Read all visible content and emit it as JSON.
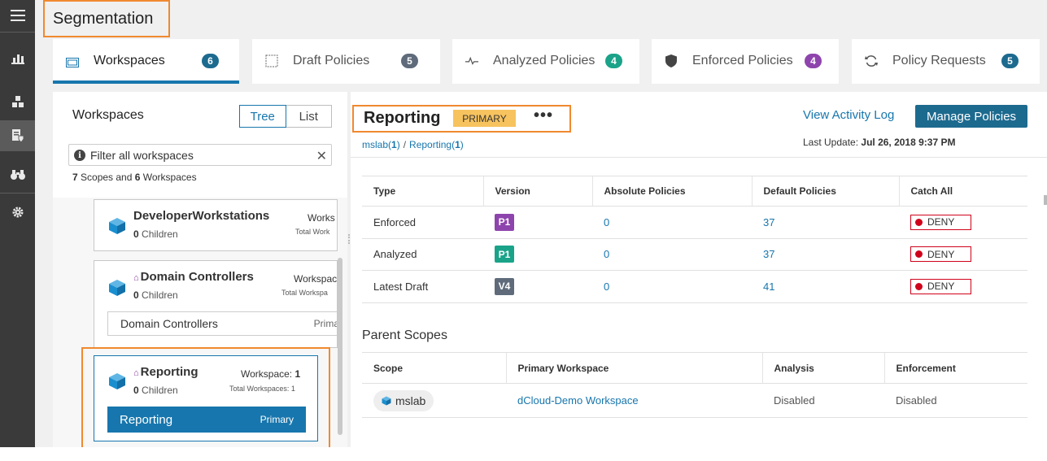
{
  "nav": {
    "items": [
      {
        "icon": "hamburger-menu-icon"
      },
      {
        "icon": "bar-chart-icon"
      },
      {
        "icon": "scopes-cubes-icon"
      },
      {
        "icon": "segmentation-shield-icon",
        "active": true
      },
      {
        "icon": "binoculars-icon"
      },
      {
        "icon": "gear-icon"
      }
    ]
  },
  "page": {
    "title": "Segmentation"
  },
  "tabs": [
    {
      "label": "Workspaces",
      "count": "6",
      "count_color": "#1d6a8f",
      "icon": "workspaces-icon",
      "active": true
    },
    {
      "label": "Draft Policies",
      "count": "5",
      "count_color": "#5f6b7a",
      "icon": "draft-square-icon"
    },
    {
      "label": "Analyzed Policies",
      "count": "4",
      "count_color": "#1aa389",
      "icon": "pulse-icon"
    },
    {
      "label": "Enforced Policies",
      "count": "4",
      "count_color": "#8e44ad",
      "icon": "shield-icon"
    },
    {
      "label": "Policy Requests",
      "count": "5",
      "count_color": "#1d6a8f",
      "icon": "refresh-icon"
    }
  ],
  "workspaces_panel": {
    "title": "Workspaces",
    "toggle": {
      "tree": "Tree",
      "list": "List"
    },
    "filter_placeholder": "Filter all workspaces",
    "scope_count": {
      "scopes": "7",
      "scopes_text": " Scopes and ",
      "workspaces": "6",
      "workspaces_text": " Workspaces"
    },
    "nodes": [
      {
        "name": "DeveloperWorkstations",
        "children_count": "0",
        "children_label": " Children",
        "ws_label": "Works",
        "tws_label": "Total Work"
      },
      {
        "name": "Domain Controllers",
        "children_count": "0",
        "children_label": " Children",
        "ws_label": "Workspac",
        "tws_label": "Total Workspa",
        "child_ws": "Domain Controllers",
        "child_ws_tag": "Prima"
      },
      {
        "name": "Reporting",
        "children_count": "0",
        "children_label": " Children",
        "ws_label": "Workspace: ",
        "ws_value": "1",
        "tws_label": "Total Workspaces: 1",
        "primary_ws": "Reporting",
        "primary_tag": "Primary"
      }
    ]
  },
  "detail": {
    "title": "Reporting",
    "badge": "PRIMARY",
    "more": "•••",
    "breadcrumb": [
      {
        "name": "mslab",
        "count": "1"
      },
      {
        "name": "Reporting",
        "count": "1"
      }
    ],
    "view_log": "View Activity Log",
    "manage": "Manage Policies",
    "last_update_label": "Last Update: ",
    "last_update_value": "Jul 26, 2018 9:37 PM",
    "versions_table": {
      "headers": [
        "Type",
        "Version",
        "Absolute Policies",
        "Default Policies",
        "Catch All"
      ],
      "rows": [
        {
          "type": "Enforced",
          "version": "P1",
          "version_color": "#8e44ad",
          "absolute": "0",
          "default": "37",
          "catch_all": "DENY"
        },
        {
          "type": "Analyzed",
          "version": "P1",
          "version_color": "#1aa389",
          "absolute": "0",
          "default": "37",
          "catch_all": "DENY"
        },
        {
          "type": "Latest Draft",
          "version": "V4",
          "version_color": "#5f6b7a",
          "absolute": "0",
          "default": "41",
          "catch_all": "DENY"
        }
      ]
    },
    "parent_scopes": {
      "title": "Parent Scopes",
      "headers": [
        "Scope",
        "Primary Workspace",
        "Analysis",
        "Enforcement"
      ],
      "rows": [
        {
          "scope": "mslab",
          "workspace": "dCloud-Demo Workspace",
          "analysis": "Disabled",
          "enforcement": "Disabled"
        }
      ]
    }
  }
}
